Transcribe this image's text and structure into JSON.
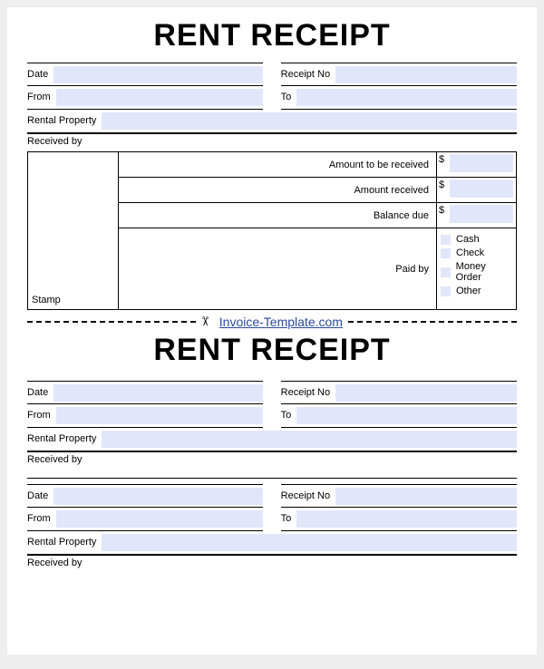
{
  "receipt1": {
    "title": "RENT RECEIPT",
    "date_label": "Date",
    "receipt_no_label": "Receipt No",
    "from_label": "From",
    "to_label": "To",
    "rental_property_label": "Rental Property",
    "received_by_label": "Received by",
    "stamp_label": "Stamp",
    "amount_to_be_received_label": "Amount to be received",
    "amount_received_label": "Amount received",
    "balance_due_label": "Balance due",
    "paid_by_label": "Paid by",
    "currency": "$",
    "pay_options": {
      "cash": "Cash",
      "check": "Check",
      "money_order": "Money Order",
      "other": "Other"
    }
  },
  "cutline": {
    "link_text": "Invoice-Template.com"
  },
  "receipt2": {
    "title": "RENT RECEIPT",
    "block_a": {
      "date_label": "Date",
      "receipt_no_label": "Receipt No",
      "from_label": "From",
      "to_label": "To",
      "rental_property_label": "Rental Property",
      "received_by_label": "Received by"
    },
    "block_b": {
      "date_label": "Date",
      "receipt_no_label": "Receipt No",
      "from_label": "From",
      "to_label": "To",
      "rental_property_label": "Rental Property",
      "received_by_label": "Received by"
    }
  }
}
